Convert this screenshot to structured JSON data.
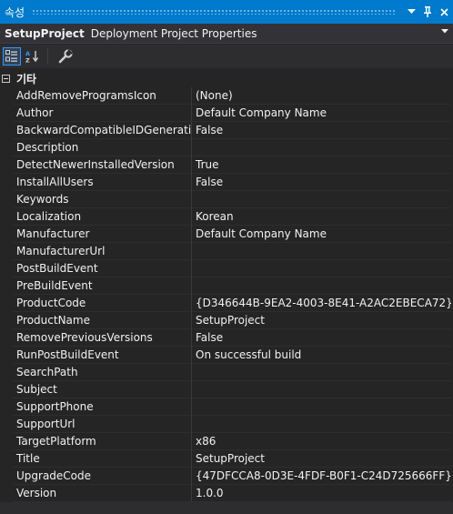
{
  "window": {
    "title": "속성"
  },
  "object_selector": {
    "name": "SetupProject",
    "type": "Deployment Project Properties"
  },
  "category": {
    "label": "기타"
  },
  "properties": [
    {
      "name": "AddRemoveProgramsIcon",
      "value": "(None)"
    },
    {
      "name": "Author",
      "value": "Default Company Name"
    },
    {
      "name": "BackwardCompatibleIDGeneration",
      "value": "False"
    },
    {
      "name": "Description",
      "value": ""
    },
    {
      "name": "DetectNewerInstalledVersion",
      "value": "True"
    },
    {
      "name": "InstallAllUsers",
      "value": "False"
    },
    {
      "name": "Keywords",
      "value": ""
    },
    {
      "name": "Localization",
      "value": "Korean"
    },
    {
      "name": "Manufacturer",
      "value": "Default Company Name"
    },
    {
      "name": "ManufacturerUrl",
      "value": ""
    },
    {
      "name": "PostBuildEvent",
      "value": ""
    },
    {
      "name": "PreBuildEvent",
      "value": ""
    },
    {
      "name": "ProductCode",
      "value": "{D346644B-9EA2-4003-8E41-A2AC2EBECA72}"
    },
    {
      "name": "ProductName",
      "value": "SetupProject"
    },
    {
      "name": "RemovePreviousVersions",
      "value": "False"
    },
    {
      "name": "RunPostBuildEvent",
      "value": "On successful build"
    },
    {
      "name": "SearchPath",
      "value": ""
    },
    {
      "name": "Subject",
      "value": ""
    },
    {
      "name": "SupportPhone",
      "value": ""
    },
    {
      "name": "SupportUrl",
      "value": ""
    },
    {
      "name": "TargetPlatform",
      "value": "x86"
    },
    {
      "name": "Title",
      "value": "SetupProject"
    },
    {
      "name": "UpgradeCode",
      "value": "{47DFCCA8-0D3E-4FDF-B0F1-C24D725666FF}"
    },
    {
      "name": "Version",
      "value": "1.0.0"
    }
  ],
  "toolbar": {
    "icons": [
      "categorized-icon",
      "alphabetical-icon",
      "property-pages-icon"
    ]
  },
  "colors": {
    "accent": "#007acc",
    "background": "#252526",
    "text": "#f1f1f1"
  }
}
